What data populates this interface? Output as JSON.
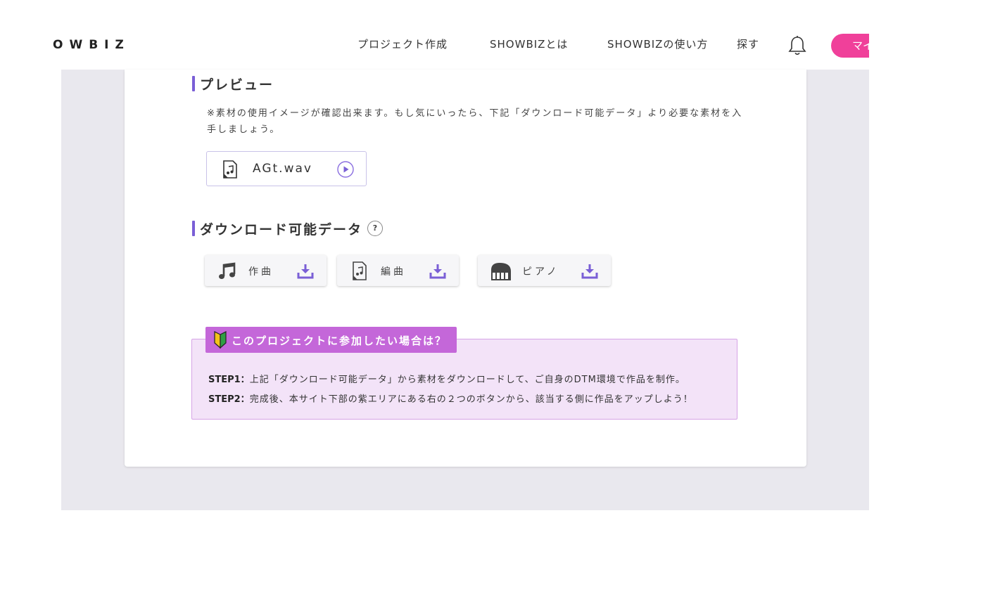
{
  "header": {
    "logo": "OWBIZ",
    "nav": [
      "プロジェクト作成",
      "SHOWBIZとは",
      "SHOWBIZの使い方",
      "探す"
    ],
    "my_button": "マイ",
    "bell_icon": "bell-icon"
  },
  "preview": {
    "title": "プレビュー",
    "note": "※素材の使用イメージが確認出来ます。もし気にいったら、下記「ダウンロード可能データ」より必要な素材を入手しましょう。",
    "file": {
      "name": "AGt.wav",
      "icon": "audio-file-icon",
      "action_icon": "play-icon"
    }
  },
  "downloads": {
    "title": "ダウンロード可能データ",
    "help": "?",
    "items": [
      {
        "label": "作曲",
        "icon": "music-note-icon"
      },
      {
        "label": "編曲",
        "icon": "score-file-icon"
      },
      {
        "label": "ピアノ",
        "icon": "piano-icon"
      }
    ],
    "download_icon": "download-icon"
  },
  "join": {
    "title": "このプロジェクトに参加したい場合は？",
    "badge_icon": "beginner-mark-icon",
    "step1_label": "STEP1：",
    "step1_text": "上記「ダウンロード可能データ」から素材をダウンロードして、ご自身のDTM環境で作品を制作。",
    "step2_label": "STEP2：",
    "step2_text": "完成後、本サイト下部の紫エリアにある右の２つのボタンから、該当する側に作品をアップしよう！"
  },
  "colors": {
    "accent": "#7a5fd6",
    "pink": "#f0409a",
    "tag": "#c467d9",
    "info_bg": "#f3e3f8",
    "page_bg": "#e9e8ee"
  }
}
